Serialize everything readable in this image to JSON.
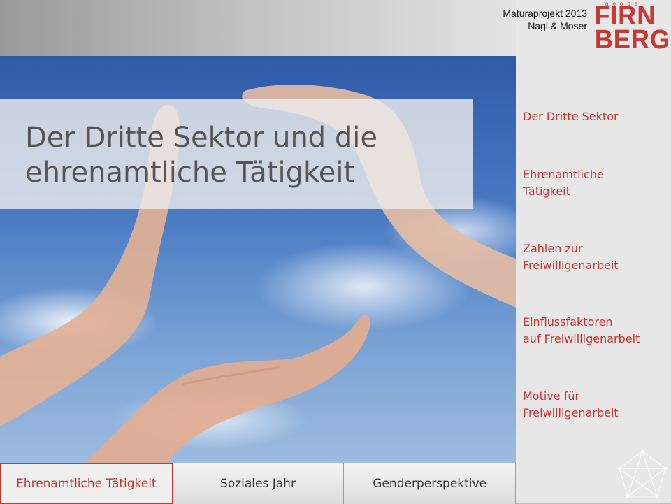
{
  "header": {
    "credit_line1": "Maturaprojekt 2013",
    "credit_line2": "Nagl & Moser",
    "logo_word1": "FIRN",
    "logo_word2": "BERG",
    "logo_tiny": "aeobe"
  },
  "slide": {
    "title": "Der Dritte Sektor und die ehrenamtliche Tätigkeit"
  },
  "sidebar": {
    "items": [
      {
        "label": "Der Dritte Sektor"
      },
      {
        "label": "Ehrenamtliche\nTätigkeit"
      },
      {
        "label": "Zahlen zur\nFreiwilligenarbeit"
      },
      {
        "label": "Einflussfaktoren\nauf Freiwilligenarbeit"
      },
      {
        "label": "Motive für\nFreiwilligenarbeit"
      }
    ]
  },
  "tabs": [
    {
      "label": "Ehrenamtliche Tätigkeit",
      "active": true
    },
    {
      "label": "Soziales Jahr",
      "active": false
    },
    {
      "label": "Genderperspektive",
      "active": false
    }
  ],
  "colors": {
    "accent": "#c8332d",
    "title_text": "#555555"
  },
  "icons": {
    "hero": "hands-sky-photo",
    "corner": "network-pentagon-icon"
  }
}
